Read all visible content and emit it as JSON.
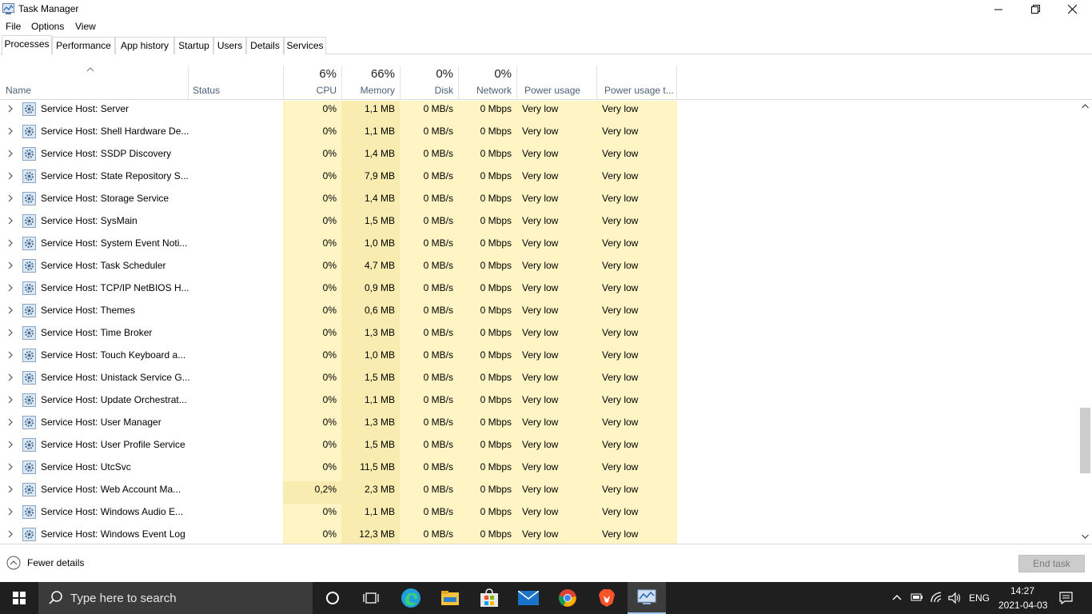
{
  "window": {
    "title": "Task Manager"
  },
  "menu": [
    "File",
    "Options",
    "View"
  ],
  "tabs": [
    "Processes",
    "Performance",
    "App history",
    "Startup",
    "Users",
    "Details",
    "Services"
  ],
  "header": {
    "name": "Name",
    "status": "Status",
    "cpu": {
      "pct": "6%",
      "label": "CPU"
    },
    "memory": {
      "pct": "66%",
      "label": "Memory"
    },
    "disk": {
      "pct": "0%",
      "label": "Disk"
    },
    "network": {
      "pct": "0%",
      "label": "Network"
    },
    "power": "Power usage",
    "power_trend": "Power usage t..."
  },
  "rows": [
    {
      "name": "Service Host: Server",
      "cpu": "0%",
      "mem": "1,1 MB",
      "disk": "0 MB/s",
      "net": "0 Mbps",
      "power": "Very low",
      "trend": "Very low"
    },
    {
      "name": "Service Host: Shell Hardware De...",
      "cpu": "0%",
      "mem": "1,1 MB",
      "disk": "0 MB/s",
      "net": "0 Mbps",
      "power": "Very low",
      "trend": "Very low"
    },
    {
      "name": "Service Host: SSDP Discovery",
      "cpu": "0%",
      "mem": "1,4 MB",
      "disk": "0 MB/s",
      "net": "0 Mbps",
      "power": "Very low",
      "trend": "Very low"
    },
    {
      "name": "Service Host: State Repository S...",
      "cpu": "0%",
      "mem": "7,9 MB",
      "disk": "0 MB/s",
      "net": "0 Mbps",
      "power": "Very low",
      "trend": "Very low"
    },
    {
      "name": "Service Host: Storage Service",
      "cpu": "0%",
      "mem": "1,4 MB",
      "disk": "0 MB/s",
      "net": "0 Mbps",
      "power": "Very low",
      "trend": "Very low"
    },
    {
      "name": "Service Host: SysMain",
      "cpu": "0%",
      "mem": "1,5 MB",
      "disk": "0 MB/s",
      "net": "0 Mbps",
      "power": "Very low",
      "trend": "Very low"
    },
    {
      "name": "Service Host: System Event Noti...",
      "cpu": "0%",
      "mem": "1,0 MB",
      "disk": "0 MB/s",
      "net": "0 Mbps",
      "power": "Very low",
      "trend": "Very low"
    },
    {
      "name": "Service Host: Task Scheduler",
      "cpu": "0%",
      "mem": "4,7 MB",
      "disk": "0 MB/s",
      "net": "0 Mbps",
      "power": "Very low",
      "trend": "Very low"
    },
    {
      "name": "Service Host: TCP/IP NetBIOS H...",
      "cpu": "0%",
      "mem": "0,9 MB",
      "disk": "0 MB/s",
      "net": "0 Mbps",
      "power": "Very low",
      "trend": "Very low"
    },
    {
      "name": "Service Host: Themes",
      "cpu": "0%",
      "mem": "0,6 MB",
      "disk": "0 MB/s",
      "net": "0 Mbps",
      "power": "Very low",
      "trend": "Very low"
    },
    {
      "name": "Service Host: Time Broker",
      "cpu": "0%",
      "mem": "1,3 MB",
      "disk": "0 MB/s",
      "net": "0 Mbps",
      "power": "Very low",
      "trend": "Very low"
    },
    {
      "name": "Service Host: Touch Keyboard a...",
      "cpu": "0%",
      "mem": "1,0 MB",
      "disk": "0 MB/s",
      "net": "0 Mbps",
      "power": "Very low",
      "trend": "Very low"
    },
    {
      "name": "Service Host: Unistack Service G...",
      "cpu": "0%",
      "mem": "1,5 MB",
      "disk": "0 MB/s",
      "net": "0 Mbps",
      "power": "Very low",
      "trend": "Very low"
    },
    {
      "name": "Service Host: Update Orchestrat...",
      "cpu": "0%",
      "mem": "1,1 MB",
      "disk": "0 MB/s",
      "net": "0 Mbps",
      "power": "Very low",
      "trend": "Very low"
    },
    {
      "name": "Service Host: User Manager",
      "cpu": "0%",
      "mem": "1,3 MB",
      "disk": "0 MB/s",
      "net": "0 Mbps",
      "power": "Very low",
      "trend": "Very low"
    },
    {
      "name": "Service Host: User Profile Service",
      "cpu": "0%",
      "mem": "1,5 MB",
      "disk": "0 MB/s",
      "net": "0 Mbps",
      "power": "Very low",
      "trend": "Very low"
    },
    {
      "name": "Service Host: UtcSvc",
      "cpu": "0%",
      "mem": "11,5 MB",
      "disk": "0 MB/s",
      "net": "0 Mbps",
      "power": "Very low",
      "trend": "Very low"
    },
    {
      "name": "Service Host: Web Account Ma...",
      "cpu": "0,2%",
      "mem": "2,3 MB",
      "disk": "0 MB/s",
      "net": "0 Mbps",
      "power": "Very low",
      "trend": "Very low"
    },
    {
      "name": "Service Host: Windows Audio E...",
      "cpu": "0%",
      "mem": "1,1 MB",
      "disk": "0 MB/s",
      "net": "0 Mbps",
      "power": "Very low",
      "trend": "Very low"
    },
    {
      "name": "Service Host: Windows Event Log",
      "cpu": "0%",
      "mem": "12,3 MB",
      "disk": "0 MB/s",
      "net": "0 Mbps",
      "power": "Very low",
      "trend": "Very low"
    }
  ],
  "footer": {
    "fewer_details": "Fewer details",
    "end_task": "End task"
  },
  "taskbar": {
    "search_placeholder": "Type here to search",
    "language": "ENG",
    "time": "14:27",
    "date": "2021-04-03",
    "pinned": [
      "task-view-icon",
      "edge-icon",
      "file-explorer-icon",
      "store-icon",
      "mail-icon",
      "chrome-icon",
      "brave-icon",
      "task-manager-icon"
    ]
  },
  "colors": {
    "highlight": "#fff4c4",
    "highlight_strong": "#f9ecb0",
    "header_label": "#4c607a",
    "taskbar": "#1f1f1f"
  }
}
